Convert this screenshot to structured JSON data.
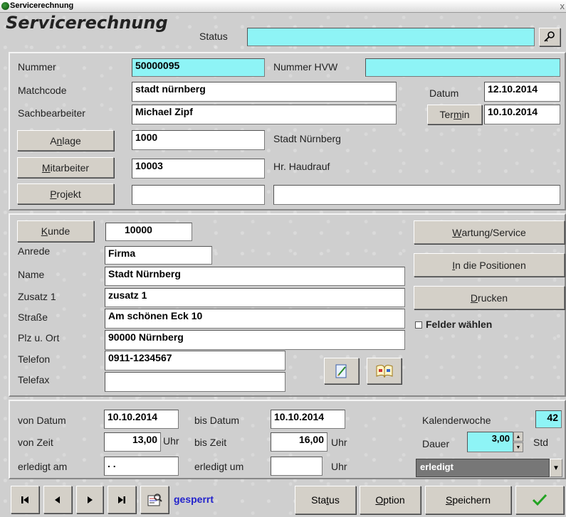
{
  "window": {
    "title": "Servicerechnung",
    "close": "x"
  },
  "header": {
    "title": "Servicerechnung",
    "status_label": "Status",
    "status_value": ""
  },
  "sec1": {
    "nummer_label": "Nummer",
    "nummer": "50000095",
    "nummer_hvw_label": "Nummer HVW",
    "nummer_hvw": "",
    "matchcode_label": "Matchcode",
    "matchcode": "stadt nürnberg",
    "datum_label": "Datum",
    "datum": "12.10.2014",
    "sachbearbeiter_label": "Sachbearbeiter",
    "sachbearbeiter": "Michael Zipf",
    "termin_pre": "Ter",
    "termin_u": "m",
    "termin_post": "in",
    "termin": "10.10.2014",
    "anlage_pre": "A",
    "anlage_u": "n",
    "anlage_post": "lage",
    "anlage": "1000",
    "anlage_text": "Stadt Nürnberg",
    "mitarbeiter_u": "M",
    "mitarbeiter_post": "itarbeiter",
    "mitarbeiter": "10003",
    "mitarbeiter_text": "Hr. Haudrauf",
    "projekt_u": "P",
    "projekt_post": "rojekt",
    "projekt": "",
    "projekt_text": ""
  },
  "sec2": {
    "kunde_u": "K",
    "kunde_post": "unde",
    "kunde": "10000",
    "anrede_label": "Anrede",
    "anrede": "Firma",
    "name_label": "Name",
    "name": "Stadt Nürnberg",
    "zusatz_label": "Zusatz 1",
    "zusatz": "zusatz 1",
    "strasse_label": "Straße",
    "strasse": "Am schönen Eck 10",
    "plzort_label": "Plz u. Ort",
    "plzort": "90000 Nürnberg",
    "telefon_label": "Telefon",
    "telefon": "0911-1234567",
    "telefax_label": "Telefax",
    "telefax": "",
    "wartung_u": "W",
    "wartung_post": "artung/Service",
    "positionen_u": "I",
    "positionen_post": "n die Positionen",
    "drucken_u": "D",
    "drucken_post": "rucken",
    "felder_label": "Felder wählen"
  },
  "sec3": {
    "von_datum_label": "von Datum",
    "von_datum": "10.10.2014",
    "bis_datum_label": "bis Datum",
    "bis_datum": "10.10.2014",
    "kw_label": "Kalenderwoche",
    "kw": "42",
    "von_zeit_label": "von Zeit",
    "von_zeit": "13,00",
    "uhr": "Uhr",
    "bis_zeit_label": "bis Zeit",
    "bis_zeit": "16,00",
    "dauer_label": "Dauer",
    "dauer": "3,00",
    "std": "Std",
    "erledigt_am_label": "erledigt am",
    "erledigt_am": ". .",
    "erledigt_um_label": "erledigt um",
    "erledigt_um": "",
    "status_select": "erledigt"
  },
  "footer": {
    "gesperrt": "gesperrt",
    "status_pre": "Sta",
    "status_u": "t",
    "status_post": "us",
    "option_u": "O",
    "option_post": "ption",
    "speichern_u": "S",
    "speichern_post": "peichern"
  }
}
